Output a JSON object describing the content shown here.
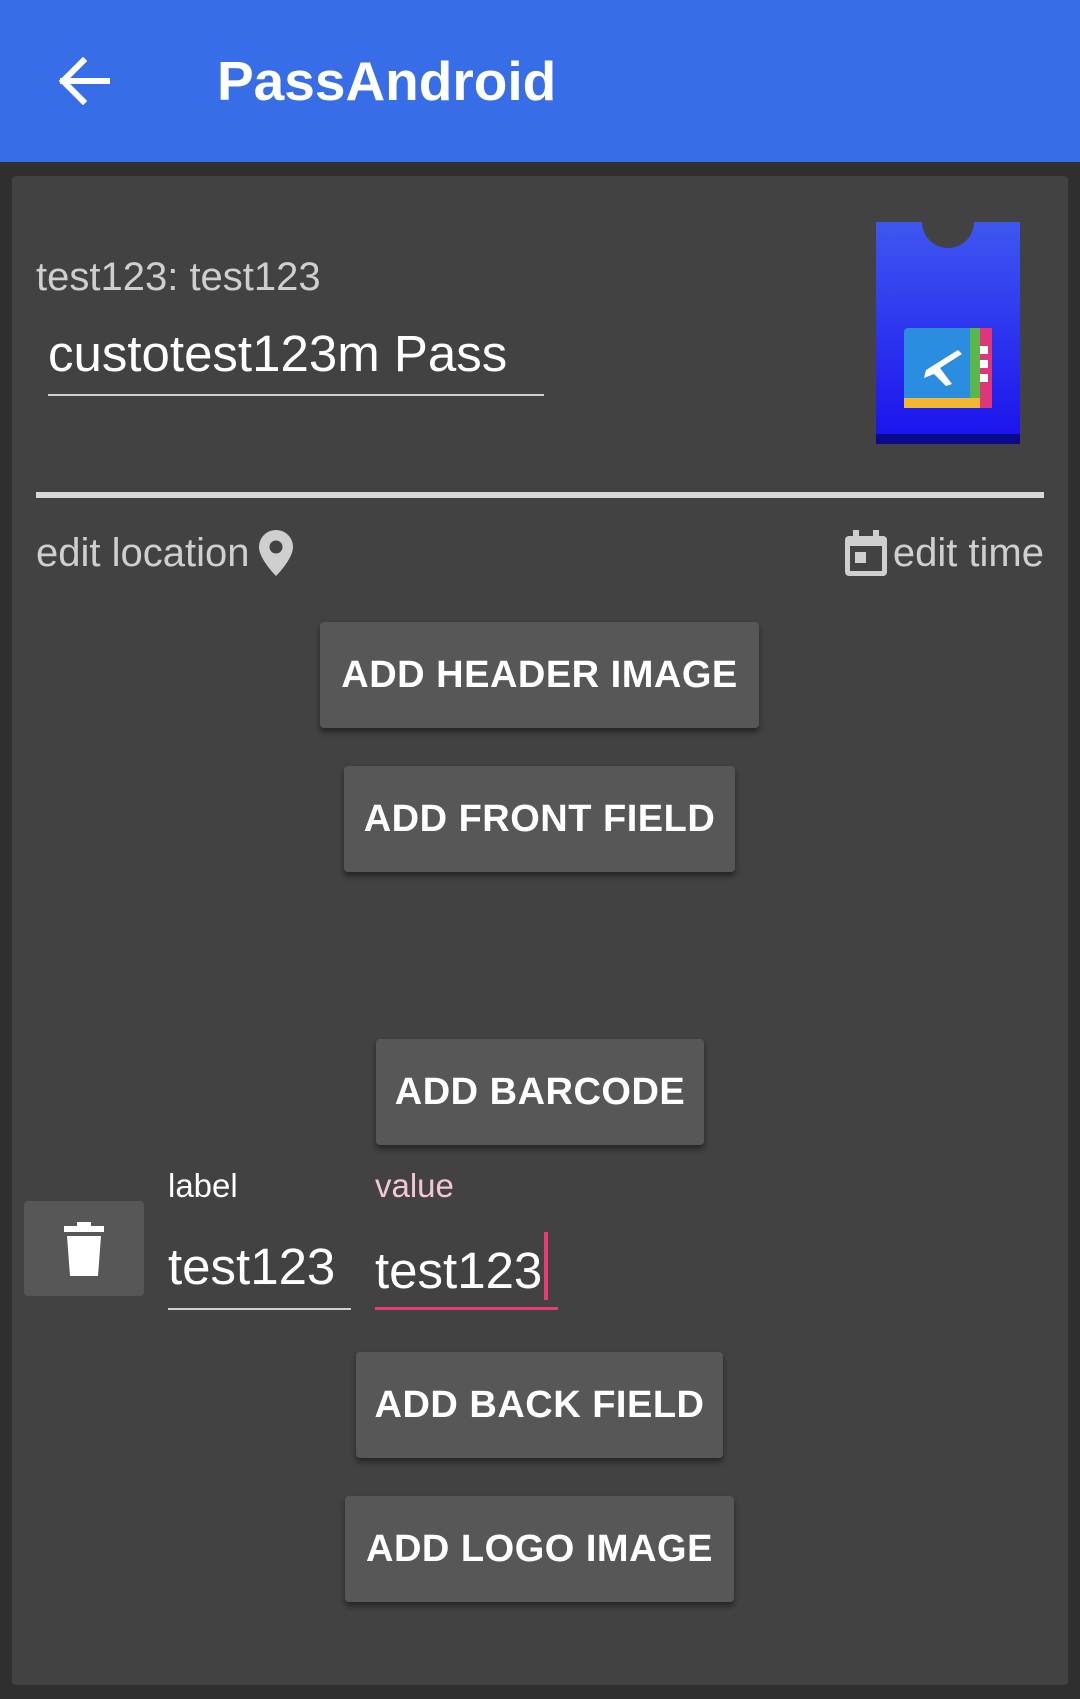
{
  "appbar": {
    "title": "PassAndroid",
    "back_icon": "arrow-back-icon"
  },
  "pass": {
    "subtitle": "test123: test123",
    "name_value": "custotest123m Pass",
    "thumbnail_icon": "airplane-pass-icon"
  },
  "actions": {
    "edit_location": "edit location",
    "location_icon": "location-pin-icon",
    "edit_time": "edit time",
    "time_icon": "calendar-icon"
  },
  "buttons": {
    "add_header_image": "ADD HEADER IMAGE",
    "add_front_field": "ADD FRONT FIELD",
    "add_barcode": "ADD BARCODE",
    "add_back_field": "ADD BACK FIELD",
    "add_logo_image": "ADD LOGO IMAGE"
  },
  "back_field": {
    "label_caption": "label",
    "label_value": "test123",
    "value_caption": "value",
    "value_value": "test123",
    "delete_icon": "trash-icon"
  },
  "colors": {
    "appbar": "#386de8",
    "card": "#424242",
    "focus_accent": "#e63c7a"
  }
}
